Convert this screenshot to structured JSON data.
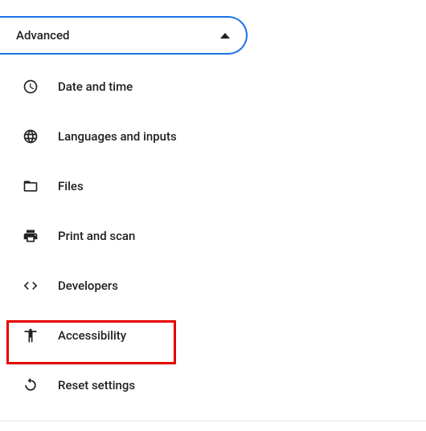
{
  "header": {
    "label": "Advanced",
    "expanded": true
  },
  "menu": {
    "items": [
      {
        "icon": "clock-icon",
        "label": "Date and time"
      },
      {
        "icon": "globe-icon",
        "label": "Languages and inputs"
      },
      {
        "icon": "folder-icon",
        "label": "Files"
      },
      {
        "icon": "printer-icon",
        "label": "Print and scan"
      },
      {
        "icon": "code-icon",
        "label": "Developers"
      },
      {
        "icon": "accessibility-icon",
        "label": "Accessibility"
      },
      {
        "icon": "reset-icon",
        "label": "Reset settings"
      }
    ]
  },
  "highlight": {
    "target_index": 5
  }
}
